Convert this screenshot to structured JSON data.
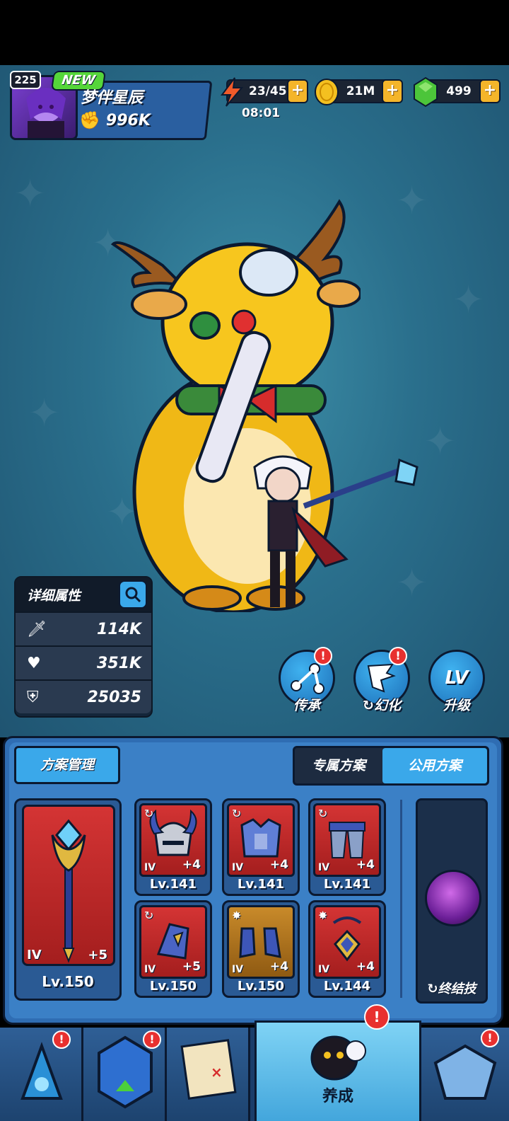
{
  "player": {
    "level": "225",
    "new_badge": "NEW",
    "name": "梦伴星辰",
    "power": "996K"
  },
  "resources": {
    "stamina": "23/45",
    "stamina_timer": "08:01",
    "gold": "21M",
    "gems": "499",
    "plus": "+"
  },
  "stats": {
    "title": "详细属性",
    "attack": "114K",
    "hp": "351K",
    "defense": "25035"
  },
  "actions": {
    "inherit": "传承",
    "transform": "幻化",
    "upgrade": "升级",
    "upgrade_icon_text": "LV",
    "alert": "!"
  },
  "loadout": {
    "manage_button": "方案管理",
    "tab_exclusive": "专属方案",
    "tab_shared": "公用方案",
    "weapon": {
      "tier": "IV",
      "plus": "+5",
      "level": "Lv.150"
    },
    "equipment": [
      {
        "tier": "IV",
        "plus": "+4",
        "level": "Lv.141",
        "frame": "red",
        "name": "horned-helmet"
      },
      {
        "tier": "IV",
        "plus": "+4",
        "level": "Lv.141",
        "frame": "red",
        "name": "chest-armor"
      },
      {
        "tier": "IV",
        "plus": "+4",
        "level": "Lv.141",
        "frame": "red",
        "name": "leg-armor"
      },
      {
        "tier": "IV",
        "plus": "+5",
        "level": "Lv.150",
        "frame": "red",
        "name": "gauntlet"
      },
      {
        "tier": "IV",
        "plus": "+4",
        "level": "Lv.150",
        "frame": "gold",
        "name": "boots"
      },
      {
        "tier": "IV",
        "plus": "+4",
        "level": "Lv.144",
        "frame": "red",
        "name": "amulet"
      }
    ],
    "ultimate_label": "终结技"
  },
  "nav": {
    "active_label": "养成"
  },
  "colors": {
    "accent_blue": "#3aa8ea",
    "frame_red": "#d43434",
    "frame_gold": "#c88a2a",
    "alert_red": "#e8302f"
  }
}
